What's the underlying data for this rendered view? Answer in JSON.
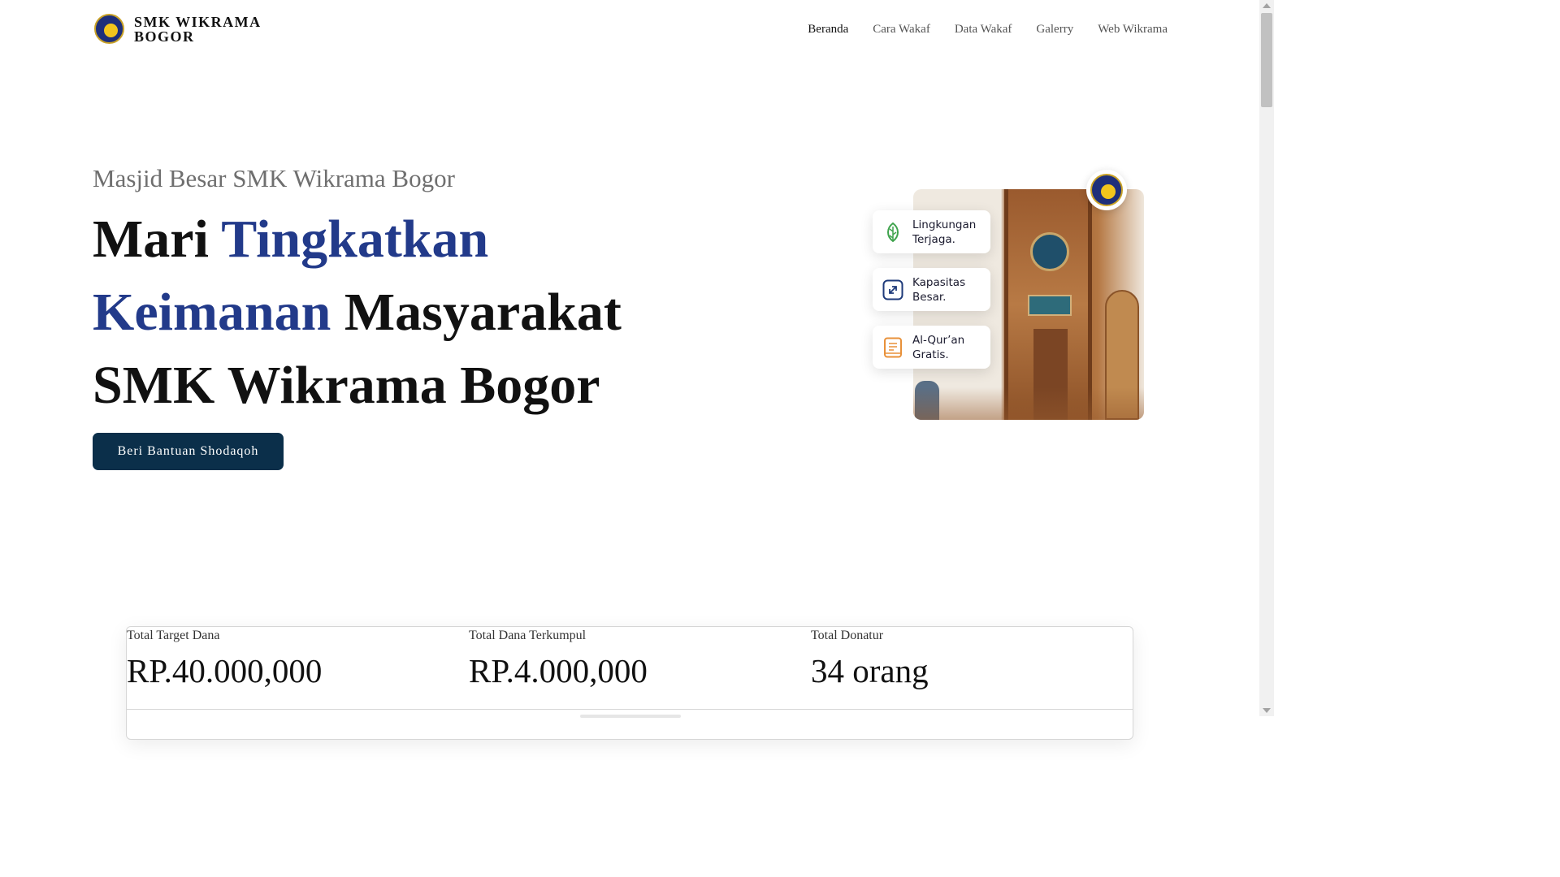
{
  "brand": {
    "line1": "SMK WIKRAMA",
    "line2": "BOGOR",
    "logo_icon": "school-emblem-icon"
  },
  "nav": {
    "items": [
      {
        "label": "Beranda",
        "active": true
      },
      {
        "label": "Cara Wakaf",
        "active": false
      },
      {
        "label": "Data Wakaf",
        "active": false
      },
      {
        "label": "Galerry",
        "active": false
      },
      {
        "label": "Web Wikrama",
        "active": false
      }
    ]
  },
  "hero": {
    "subtitle": "Masjid Besar SMK Wikrama Bogor",
    "title_part1": "Mari ",
    "title_highlight1": "Tingkatkan",
    "title_highlight2": "Keimanan",
    "title_part2": " Masyarakat",
    "title_part3": "SMK Wikrama Bogor",
    "cta_label": "Beri Bantuan Shodaqoh",
    "accent_color": "#223a8a",
    "cta_color": "#0b2f4a"
  },
  "features": [
    {
      "label": "Lingkungan\nTerjaga.",
      "icon": "leaf-icon",
      "color": "#3fa34d"
    },
    {
      "label": "Kapasitas\nBesar.",
      "icon": "expand-icon",
      "color": "#1e3a7a"
    },
    {
      "label": "Al-Qur’an\nGratis.",
      "icon": "book-icon",
      "color": "#e8913a"
    }
  ],
  "stats": [
    {
      "label": "Total Target Dana",
      "value": "RP.40.000,000"
    },
    {
      "label": "Total Dana Terkumpul",
      "value": "RP.4.000,000"
    },
    {
      "label": "Total Donatur",
      "value": "34 orang"
    }
  ]
}
